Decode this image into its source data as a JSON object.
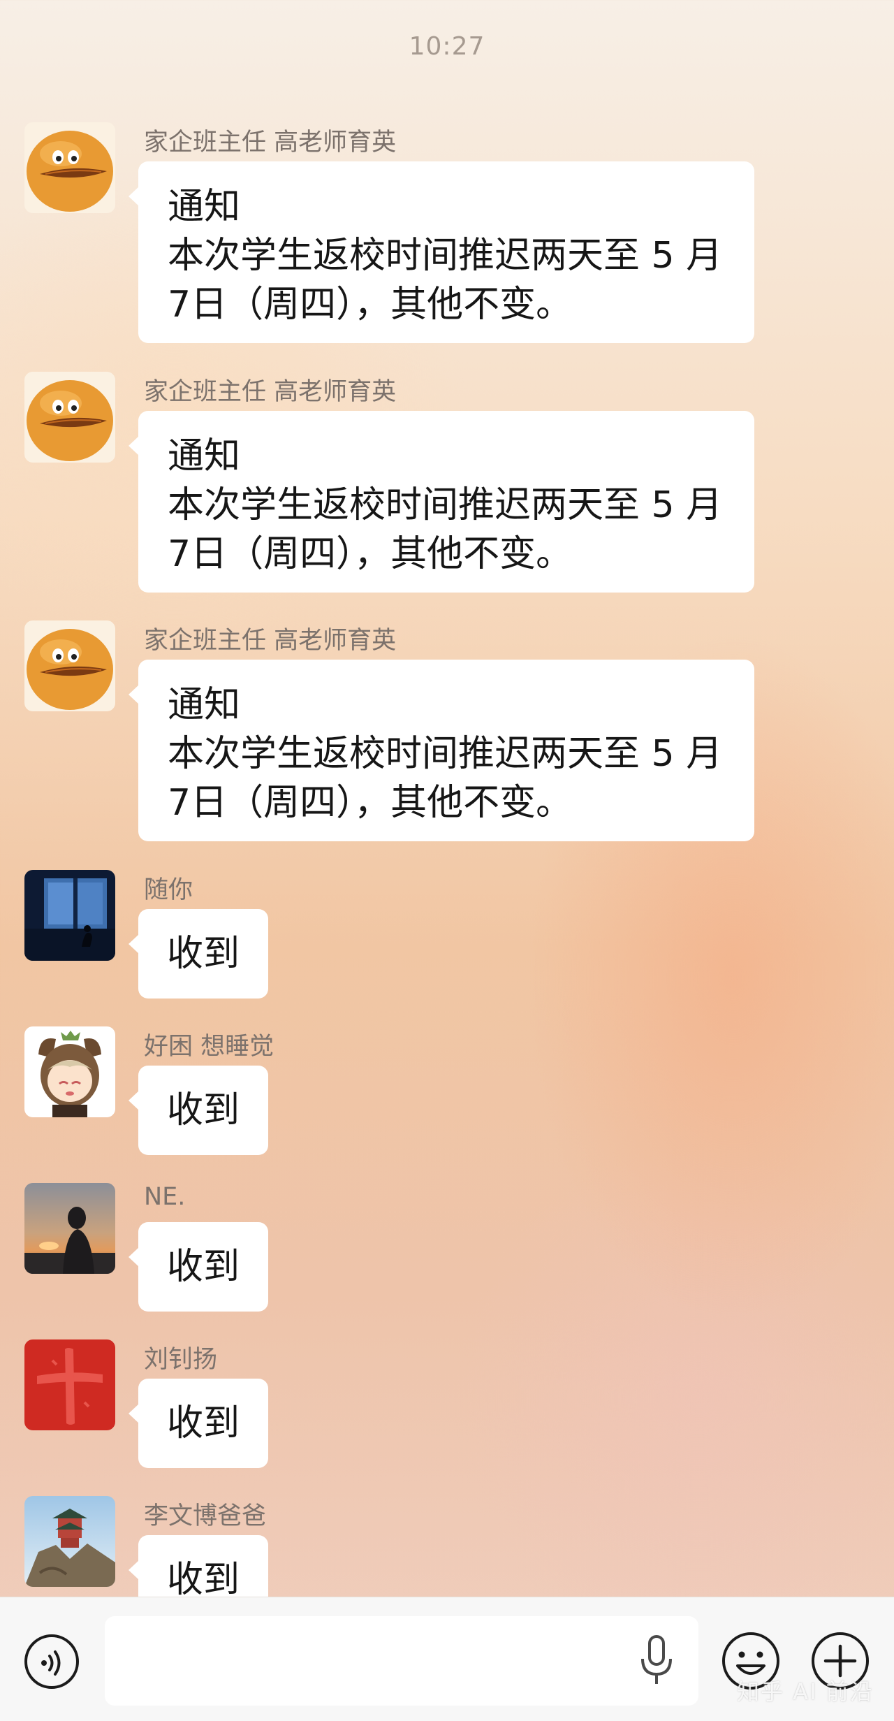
{
  "status": {
    "time": "10:27"
  },
  "messages": [
    {
      "sender": "家企班主任 高老师育英",
      "avatar": "orange-smiley-avatar",
      "lines": [
        "通知",
        "本次学生返校时间推迟两天至 5 月",
        "7日（周四），其他不变。"
      ]
    },
    {
      "sender": "家企班主任 高老师育英",
      "avatar": "orange-smiley-avatar",
      "lines": [
        "通知",
        "本次学生返校时间推迟两天至 5 月",
        "7日（周四），其他不变。"
      ]
    },
    {
      "sender": "家企班主任 高老师育英",
      "avatar": "orange-smiley-avatar",
      "lines": [
        "通知",
        "本次学生返校时间推迟两天至 5 月",
        "7日（周四），其他不变。"
      ]
    },
    {
      "sender": "随你",
      "avatar": "night-window-avatar",
      "text": "收到"
    },
    {
      "sender": "好困 想睡觉",
      "avatar": "anime-character-avatar",
      "text": "收到"
    },
    {
      "sender": "NE.",
      "avatar": "sunset-silhouette-avatar",
      "text": "收到"
    },
    {
      "sender": "刘钊扬",
      "avatar": "red-cross-avatar",
      "text": "收到"
    },
    {
      "sender": "李文博爸爸",
      "avatar": "mountain-temple-avatar",
      "text": "收到"
    }
  ],
  "input_bar": {
    "placeholder": "",
    "icons": [
      "voice-icon",
      "microphone-icon",
      "emoji-icon",
      "plus-icon"
    ]
  },
  "watermark": "知乎 AI 前沿"
}
